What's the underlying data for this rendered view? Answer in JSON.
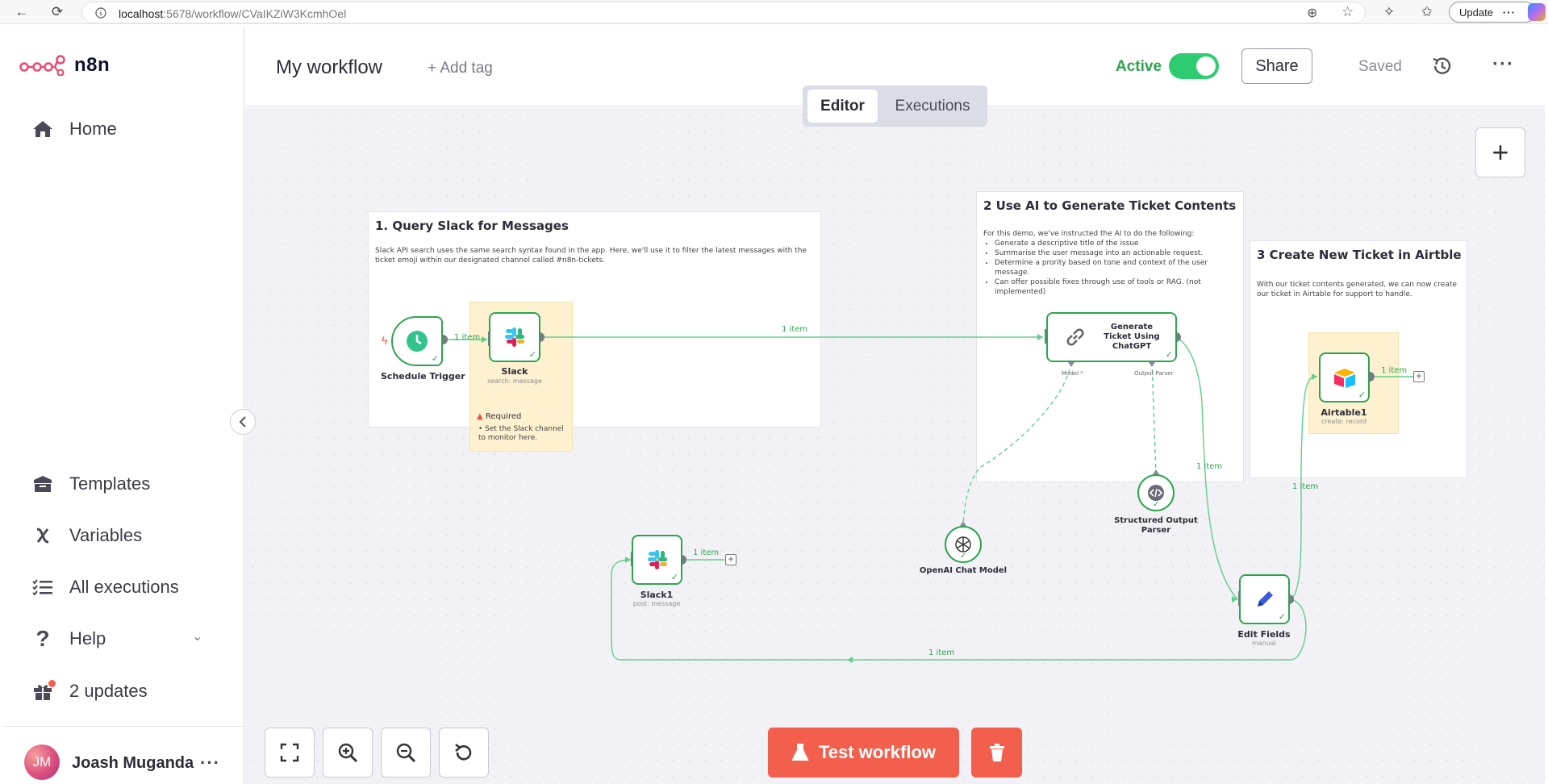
{
  "browser": {
    "url_host": "localhost",
    "url_path": ":5678/workflow/CVaIKZiW3KcmhOel",
    "update_label": "Update"
  },
  "sidebar": {
    "brand": "n8n",
    "items": [
      {
        "label": "Home",
        "icon": "home-icon"
      },
      {
        "label": "Templates",
        "icon": "templates-icon"
      },
      {
        "label": "Variables",
        "icon": "variables-icon"
      },
      {
        "label": "All executions",
        "icon": "executions-list-icon"
      },
      {
        "label": "Help",
        "icon": "help-icon"
      },
      {
        "label": "2 updates",
        "icon": "gift-icon"
      }
    ],
    "user": {
      "initials": "JM",
      "name": "Joash Muganda"
    }
  },
  "header": {
    "title": "My workflow",
    "add_tag": "+ Add tag",
    "active_label": "Active",
    "active": true,
    "share_label": "Share",
    "saved_label": "Saved",
    "tabs": [
      {
        "label": "Editor",
        "active": true
      },
      {
        "label": "Executions",
        "active": false
      }
    ]
  },
  "notes": {
    "query": {
      "title": "1. Query Slack for Messages",
      "body": "Slack API search uses the same search syntax found in the app. Here, we'll use it to filter the latest messages with the ticket emoji within our designated channel called #n8n-tickets."
    },
    "ai": {
      "title": "2 Use AI to Generate Ticket Contents",
      "intro": "For this demo, we've instructed the AI to do the following:",
      "bullets": [
        "Generate a descriptive title of the issue",
        "Summarise the user message into an actionable request.",
        "Determine a prority based on tone and context of the user message.",
        "Can offer possible fixes through use of tools or RAG. (not implemented)"
      ]
    },
    "create": {
      "title": "3 Create New Ticket in Airtble",
      "body": "With our ticket contents generated, we can now create our ticket in Airtable for support to handle."
    },
    "required": {
      "title": "Required",
      "body": "Set the Slack channel to monitor here."
    }
  },
  "nodes": {
    "schedule": {
      "label": "Schedule Trigger"
    },
    "slack": {
      "label": "Slack",
      "sub": "search: message"
    },
    "generate": {
      "label": "Generate Ticket Using ChatGPT",
      "port_model": "Model *",
      "port_parser": "Output Parser"
    },
    "airtable": {
      "label": "Airtable1",
      "sub": "create: record"
    },
    "parser": {
      "label": "Structured Output Parser"
    },
    "openai": {
      "label": "OpenAI Chat Model"
    },
    "slack1": {
      "label": "Slack1",
      "sub": "post: message"
    },
    "edit": {
      "label": "Edit Fields",
      "sub": "manual"
    }
  },
  "connections": {
    "c1": "1 item",
    "c2": "1 item",
    "c3": "1 item",
    "c4": "1 item",
    "c5": "1 item",
    "c6": "1 item",
    "c7": "1 item"
  },
  "footer": {
    "test_label": "Test workflow"
  },
  "colors": {
    "brand": "#ea4b71",
    "success": "#2ea44f",
    "accent": "#f25f4c"
  }
}
